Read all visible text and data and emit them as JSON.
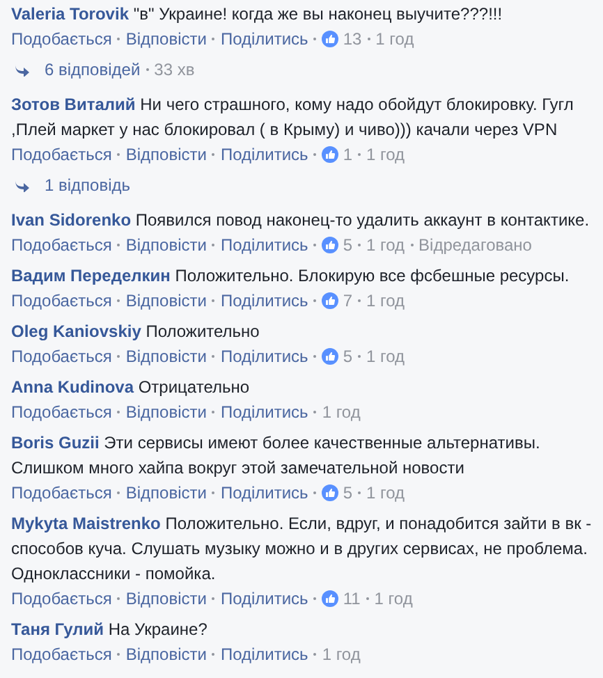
{
  "comments": [
    {
      "author": "Valeria Torovik",
      "text": "\"в\" Украине! когда же вы наконец выучите???!!!",
      "actions": [
        "Подобається",
        "Відповісти",
        "Поділитись"
      ],
      "likes": "13",
      "time": "1 год",
      "replies": {
        "label": "6 відповідей",
        "time": "33 хв"
      }
    },
    {
      "author": "Зотов Виталий",
      "text": "Ни чего страшного, кому надо обойдут блокировку. Гугл ,Плей маркет у нас блокировал ( в Крыму) и чиво))) качали через VPN",
      "actions": [
        "Подобається",
        "Відповісти",
        "Поділитись"
      ],
      "likes": "1",
      "time": "1 год",
      "replies": {
        "label": "1 відповідь"
      }
    },
    {
      "author": "Ivan Sidorenko",
      "text": "Появился повод наконец-то удалить аккаунт в контактике.",
      "actions": [
        "Подобається",
        "Відповісти",
        "Поділитись"
      ],
      "likes": "5",
      "time": "1 год",
      "edited": "Відредаговано"
    },
    {
      "author": "Вадим Переделкин",
      "text": "Положительно. Блокирую все фсбешные ресурсы.",
      "actions": [
        "Подобається",
        "Відповісти",
        "Поділитись"
      ],
      "likes": "7",
      "time": "1 год"
    },
    {
      "author": "Oleg Kaniovskiy",
      "text": "Положительно",
      "actions": [
        "Подобається",
        "Відповісти",
        "Поділитись"
      ],
      "likes": "5",
      "time": "1 год"
    },
    {
      "author": "Anna Kudinova",
      "text": "Отрицательно",
      "actions": [
        "Подобається",
        "Відповісти",
        "Поділитись"
      ],
      "time": "1 год"
    },
    {
      "author": "Boris Guzii",
      "text": "Эти сервисы имеют более качественные альтернативы. Слишком много хайпа вокруг этой замечательной новости",
      "actions": [
        "Подобається",
        "Відповісти",
        "Поділитись"
      ],
      "likes": "5",
      "time": "1 год"
    },
    {
      "author": "Mykyta Maistrenko",
      "text": "Положительно. Если, вдруг, и понадобится зайти в вк - способов куча. Слушать музыку можно и в других сервисах, не проблема. Одноклассники - помойка.",
      "actions": [
        "Подобається",
        "Відповісти",
        "Поділитись"
      ],
      "likes": "11",
      "time": "1 год"
    },
    {
      "author": "Таня Гулий",
      "text": "На Украине?",
      "actions": [
        "Подобається",
        "Відповісти",
        "Поділитись"
      ],
      "time": "1 год"
    }
  ]
}
